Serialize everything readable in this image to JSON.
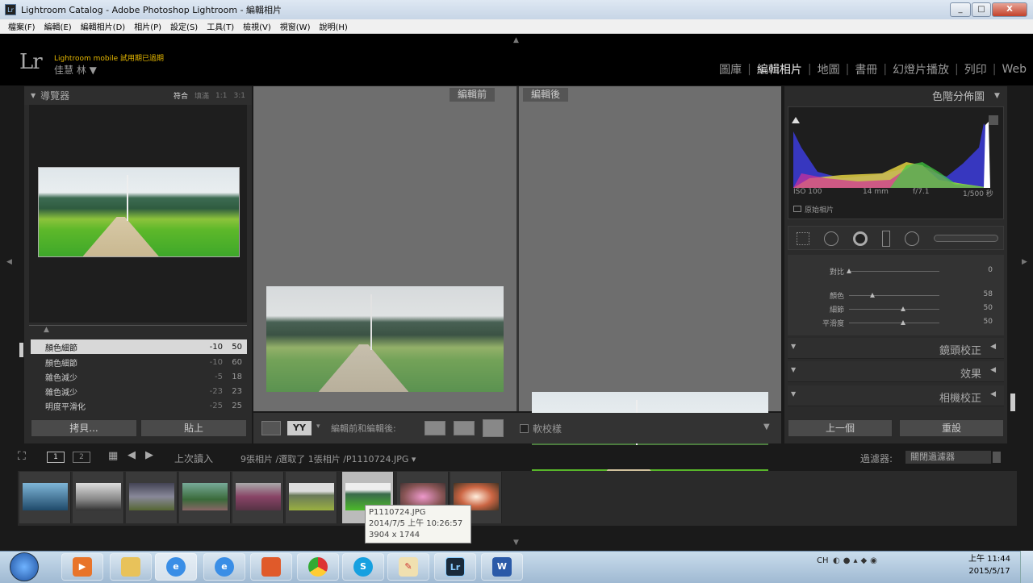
{
  "window": {
    "title": "Lightroom Catalog - Adobe Photoshop Lightroom - 編輯相片",
    "controls": [
      "_",
      "□",
      "X"
    ]
  },
  "menu": [
    "檔案(F)",
    "編輯(E)",
    "編輯相片(D)",
    "相片(P)",
    "設定(S)",
    "工具(T)",
    "檢視(V)",
    "視窗(W)",
    "說明(H)"
  ],
  "identity": {
    "logo": "Lr",
    "mobile": "Lightroom mobile 試用期已過期",
    "user": "佳慧 林 ▼"
  },
  "modules": [
    {
      "label": "圖庫"
    },
    {
      "label": "編輯相片",
      "active": true
    },
    {
      "label": "地圖"
    },
    {
      "label": "書冊"
    },
    {
      "label": "幻燈片播放"
    },
    {
      "label": "列印"
    },
    {
      "label": "Web"
    }
  ],
  "navigator": {
    "title": "導覽器",
    "zoom": [
      "符合",
      "填滿",
      "1:1",
      "3:1"
    ]
  },
  "history": {
    "rows": [
      {
        "name": "顏色細節",
        "v1": "-10",
        "v2": "50",
        "selected": true
      },
      {
        "name": "顏色細節",
        "v1": "-10",
        "v2": "60"
      },
      {
        "name": "雜色減少",
        "v1": "-5",
        "v2": "18"
      },
      {
        "name": "雜色減少",
        "v1": "-23",
        "v2": "23"
      },
      {
        "name": "明度平滑化",
        "v1": "-25",
        "v2": "25"
      }
    ]
  },
  "left_buttons": {
    "copy": "拷貝...",
    "paste": "貼上"
  },
  "compare": {
    "before": "編輯前",
    "after": "編輯後"
  },
  "toolbar": {
    "ba_label": "YY",
    "mode_label": "編輯前和編輯後:",
    "softproof": "軟校樣"
  },
  "histogram": {
    "title": "色階分佈圖",
    "iso": "ISO 100",
    "focal": "14 mm",
    "aperture": "f/7.1",
    "shutter": "1/500 秒",
    "original": "原始相片"
  },
  "detail_sliders": [
    {
      "label": "對比",
      "value": "0",
      "pos": 0.0
    },
    {
      "label": "顏色",
      "value": "58",
      "pos": 0.26
    },
    {
      "label": "細節",
      "value": "50",
      "pos": 0.6
    },
    {
      "label": "平滑度",
      "value": "50",
      "pos": 0.6
    }
  ],
  "sections": [
    "鏡頭校正",
    "效果",
    "相機校正"
  ],
  "right_buttons": {
    "previous": "上一個",
    "reset": "重設"
  },
  "filmstrip_bar": {
    "page1": "1",
    "page2": "2",
    "source": "上次讀入",
    "info": "9張相片 /選取了 1張相片 /P1110724.JPG ▾",
    "filter_label": "過濾器:",
    "filter_value": "關閉過濾器"
  },
  "tooltip": {
    "name": "P1110724.JPG",
    "date": "2014/7/5 上午 10:26:57",
    "size": "3904 x 1744"
  },
  "taskbar": {
    "lang": "CH",
    "time": "上午 11:44",
    "date": "2015/5/17"
  }
}
